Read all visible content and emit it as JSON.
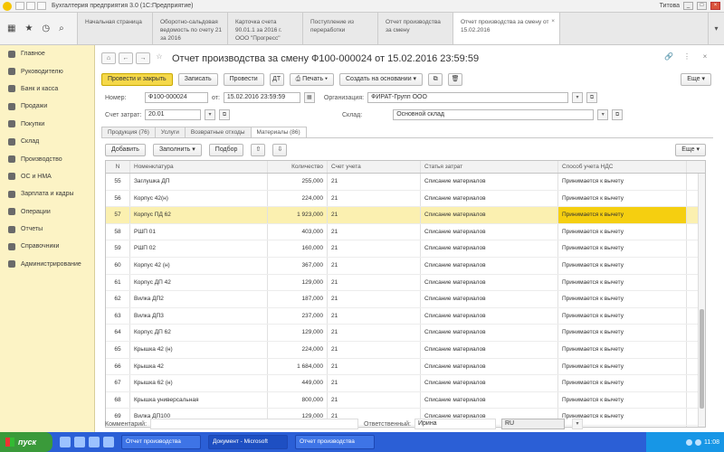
{
  "window": {
    "title": "Бухгалтерия предприятия 3.0 (1С:Предприятие)",
    "user": "Титова"
  },
  "tabs": [
    {
      "label": "Начальная страница"
    },
    {
      "label": "Оборотно-сальдовая ведомость по счету 21 за 2016"
    },
    {
      "label": "Карточка счета 90.01.1 за 2016 г. ООО \"Прогресс\""
    },
    {
      "label": "Поступление из переработки"
    },
    {
      "label": "Отчет производства за смену"
    },
    {
      "label": "Отчет производства за смену от 15.02.2016"
    }
  ],
  "sidebar": {
    "items": [
      {
        "label": "Главное",
        "icon": "menu-icon"
      },
      {
        "label": "Руководителю",
        "icon": "chart-icon"
      },
      {
        "label": "Банк и касса",
        "icon": "bank-icon"
      },
      {
        "label": "Продажи",
        "icon": "sales-icon"
      },
      {
        "label": "Покупки",
        "icon": "purchases-icon"
      },
      {
        "label": "Склад",
        "icon": "warehouse-icon"
      },
      {
        "label": "Производство",
        "icon": "production-icon"
      },
      {
        "label": "ОС и НМА",
        "icon": "assets-icon"
      },
      {
        "label": "Зарплата и кадры",
        "icon": "salary-icon"
      },
      {
        "label": "Операции",
        "icon": "operations-icon"
      },
      {
        "label": "Отчеты",
        "icon": "reports-icon"
      },
      {
        "label": "Справочники",
        "icon": "directory-icon"
      },
      {
        "label": "Администрирование",
        "icon": "admin-icon"
      }
    ]
  },
  "document": {
    "title": "Отчет производства за смену Ф100-000024 от 15.02.2016 23:59:59"
  },
  "toolbar": {
    "post_close": "Провести и закрыть",
    "save": "Записать",
    "post": "Провести",
    "print": "Печать",
    "create_based": "Создать на основании",
    "more": "Еще"
  },
  "form": {
    "number_label": "Номер:",
    "number": "Ф100-000024",
    "date_label": "от:",
    "date": "15.02.2016 23:59:59",
    "org_label": "Организация:",
    "org": "ФИРАТ-Групп ООО",
    "account_label": "Счет затрат:",
    "account": "20.01",
    "warehouse_label": "Склад:",
    "warehouse": "Основной склад"
  },
  "subtabs": [
    {
      "label": "Продукция (76)"
    },
    {
      "label": "Услуги"
    },
    {
      "label": "Возвратные отходы"
    },
    {
      "label": "Материалы (86)"
    }
  ],
  "table_tools": {
    "add": "Добавить",
    "fill": "Заполнить",
    "pick": "Подбор",
    "more": "Еще"
  },
  "table": {
    "columns": [
      "N",
      "Номенклатура",
      "Количество",
      "Счет учета",
      "Статья затрат",
      "Способ учета НДС"
    ],
    "rows": [
      [
        "55",
        "Заглушка ДП",
        "255,000",
        "21",
        "Списание материалов",
        "Принимается к вычету"
      ],
      [
        "56",
        "Корпус 42(н)",
        "224,000",
        "21",
        "Списание материалов",
        "Принимается к вычету"
      ],
      [
        "57",
        "Корпус ПД 62",
        "1 923,000",
        "21",
        "Списание материалов",
        "Принимается к вычету"
      ],
      [
        "58",
        "РШП 01",
        "403,000",
        "21",
        "Списание материалов",
        "Принимается к вычету"
      ],
      [
        "59",
        "РШП 02",
        "160,000",
        "21",
        "Списание материалов",
        "Принимается к вычету"
      ],
      [
        "60",
        "Корпус 42 (н)",
        "367,000",
        "21",
        "Списание материалов",
        "Принимается к вычету"
      ],
      [
        "61",
        "Корпус ДП 42",
        "129,000",
        "21",
        "Списание материалов",
        "Принимается к вычету"
      ],
      [
        "62",
        "Вилка ДП2",
        "187,000",
        "21",
        "Списание материалов",
        "Принимается к вычету"
      ],
      [
        "63",
        "Вилка ДП3",
        "237,000",
        "21",
        "Списание материалов",
        "Принимается к вычету"
      ],
      [
        "64",
        "Корпус ДП 62",
        "129,000",
        "21",
        "Списание материалов",
        "Принимается к вычету"
      ],
      [
        "65",
        "Крышка 42 (н)",
        "224,000",
        "21",
        "Списание материалов",
        "Принимается к вычету"
      ],
      [
        "66",
        "Крышка 42",
        "1 684,000",
        "21",
        "Списание материалов",
        "Принимается к вычету"
      ],
      [
        "67",
        "Крышка 62 (н)",
        "449,000",
        "21",
        "Списание материалов",
        "Принимается к вычету"
      ],
      [
        "68",
        "Крышка универсальная",
        "800,000",
        "21",
        "Списание материалов",
        "Принимается к вычету"
      ],
      [
        "69",
        "Вилка ДП100",
        "129,000",
        "21",
        "Списание материалов",
        "Принимается к вычету"
      ],
      [
        "70",
        "Вилка ДП02",
        "37,000",
        "10.07",
        "Списание материалов",
        "Принимается к вычету"
      ]
    ],
    "selected_index": 2
  },
  "footer": {
    "comment_label": "Комментарий:",
    "responsible_label": "Ответственный:",
    "responsible": "Ирина",
    "lang": "RU"
  },
  "taskbar": {
    "start": "пуск",
    "tasks": [
      {
        "label": "Отчет производства"
      },
      {
        "label": "Документ - Microsoft"
      },
      {
        "label": "Отчет производства"
      }
    ],
    "time": "11:08"
  }
}
